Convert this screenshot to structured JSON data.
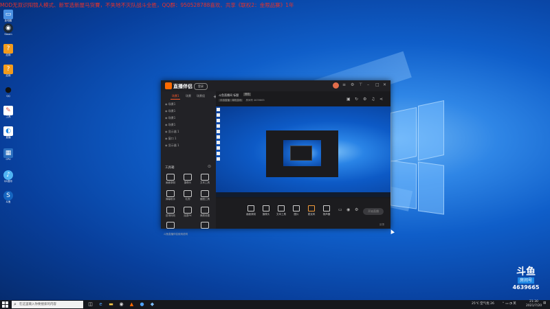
{
  "banner": {
    "text": "MOD无双识阳锦人模式、新军选新屋马货賽，不失地不灭队战斗全胜，QQ群：950528788喜欢、共享《联权2：金限品赛》1年"
  },
  "desktop_icons": [
    {
      "name": "此电脑",
      "icon": "computer-icon",
      "color": "#4a90e2"
    },
    {
      "name": "Steam",
      "icon": "steam-icon",
      "color": "#1b2838"
    },
    {
      "name": "应用",
      "icon": "app-icon",
      "color": "#f29b1c"
    },
    {
      "name": "应用",
      "icon": "app-icon",
      "color": "#f29b1c"
    },
    {
      "name": "QQ",
      "icon": "qq-icon",
      "color": "#111111"
    },
    {
      "name": "工具",
      "icon": "tool-icon",
      "color": "#d9534f"
    },
    {
      "name": "直播",
      "icon": "live-icon",
      "color": "#1e88e5"
    },
    {
      "name": "CPU",
      "icon": "cpu-icon",
      "color": "#2a6fbf"
    },
    {
      "name": "QQ音乐",
      "icon": "music-icon",
      "color": "#4fb3f2"
    },
    {
      "name": "斗鱼",
      "icon": "douyu-icon",
      "color": "#1565c0"
    }
  ],
  "app": {
    "name": "直播伴侣",
    "login": "登录",
    "tabs": [
      "场景1",
      "场景",
      "场景组"
    ],
    "scenes": [
      "场景1",
      "场景1",
      "场景1",
      "场景1",
      "显示器 1",
      "窗口 1",
      "显示器 1"
    ],
    "tools_header": "工具箱",
    "tools": [
      "画面录制",
      "摄像头",
      "文本工具",
      "弹幕助手",
      "礼物",
      "截图工具",
      "进场特效",
      "连麦PK",
      "美颜设置",
      "互动玩法",
      "打赏",
      "更多"
    ],
    "bottom_note": "斗鱼直播伴侣使用说明",
    "room_title": "斗鱼直播间 标题",
    "room_edit": "修改",
    "room_meta": [
      "手游直播 · 单机游戏",
      "房间号 4639665"
    ],
    "controls": [
      "画面录制",
      "摄像头",
      "文本工具",
      "图片",
      "麦克风",
      "扬声器"
    ],
    "start_live": "开始直播",
    "feedback": "反馈"
  },
  "taskbar": {
    "search_placeholder": "在这里输入你要搜索的内容",
    "tray_weather": "25℃ 空气优 26",
    "tray_time": "21:30",
    "tray_date": "2021/7/20"
  },
  "watermark": {
    "logo": "斗鱼",
    "label": "房间号",
    "room_id": "4639665"
  }
}
